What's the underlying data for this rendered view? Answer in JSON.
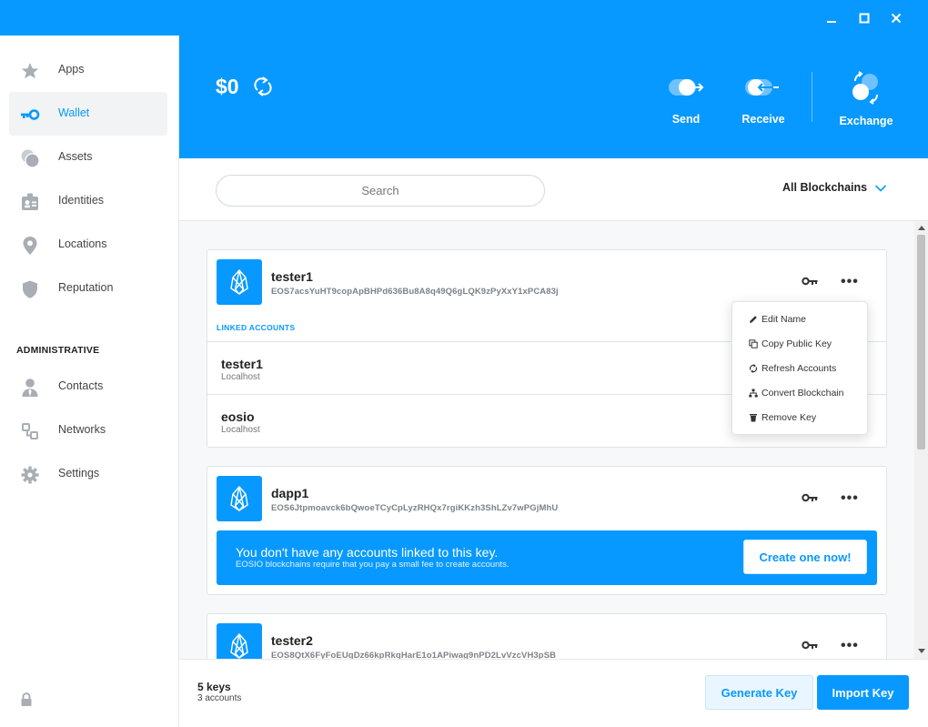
{
  "header": {
    "balance": "$0",
    "send_label": "Send",
    "receive_label": "Receive",
    "exchange_label": "Exchange"
  },
  "sidebar": {
    "items": [
      {
        "label": "Apps",
        "icon": "star-icon"
      },
      {
        "label": "Wallet",
        "icon": "key-icon"
      },
      {
        "label": "Assets",
        "icon": "coins-icon"
      },
      {
        "label": "Identities",
        "icon": "id-card-icon"
      },
      {
        "label": "Locations",
        "icon": "map-pin-icon"
      },
      {
        "label": "Reputation",
        "icon": "shield-icon"
      }
    ],
    "admin_heading": "ADMINISTRATIVE",
    "admin_items": [
      {
        "label": "Contacts",
        "icon": "user-icon"
      },
      {
        "label": "Networks",
        "icon": "network-icon"
      },
      {
        "label": "Settings",
        "icon": "gear-icon"
      }
    ],
    "active_item": "Wallet"
  },
  "search": {
    "placeholder": "Search",
    "blockchain_filter": "All Blockchains"
  },
  "keys": [
    {
      "name": "tester1",
      "public_key": "EOS7acsYuHT9copApBHPd636Bu8A8q49Q6gLQK9zPyXxY1xPCA83j",
      "linked_heading": "LINKED ACCOUNTS",
      "accounts": [
        {
          "name": "tester1",
          "network": "Localhost"
        },
        {
          "name": "eosio",
          "network": "Localhost"
        }
      ]
    },
    {
      "name": "dapp1",
      "public_key": "EOS6Jtpmoavck6bQwoeTCyCpLyzRHQx7rgiKKzh3ShLZv7wPGjMhU",
      "no_accounts_title": "You don't have any accounts linked to this key.",
      "no_accounts_sub": "EOSIO blockchains require that you pay a small fee to create accounts.",
      "create_label": "Create one now!"
    },
    {
      "name": "tester2",
      "public_key": "EOS8QtX6FyFoEUqDz66kpRkqHarE1o1APiwag9nPD2LvVzcVH3pSB"
    }
  ],
  "context_menu": {
    "items": [
      {
        "label": "Edit Name",
        "icon": "pencil-icon"
      },
      {
        "label": "Copy Public Key",
        "icon": "copy-icon"
      },
      {
        "label": "Refresh Accounts",
        "icon": "refresh-icon"
      },
      {
        "label": "Convert Blockchain",
        "icon": "hierarchy-icon"
      },
      {
        "label": "Remove Key",
        "icon": "trash-icon"
      }
    ]
  },
  "footer": {
    "keys_count": "5 keys",
    "accounts_count": "3 accounts",
    "generate_label": "Generate Key",
    "import_label": "Import Key"
  },
  "colors": {
    "accent": "#0799ff",
    "icon_gray": "#a8aeb4"
  }
}
